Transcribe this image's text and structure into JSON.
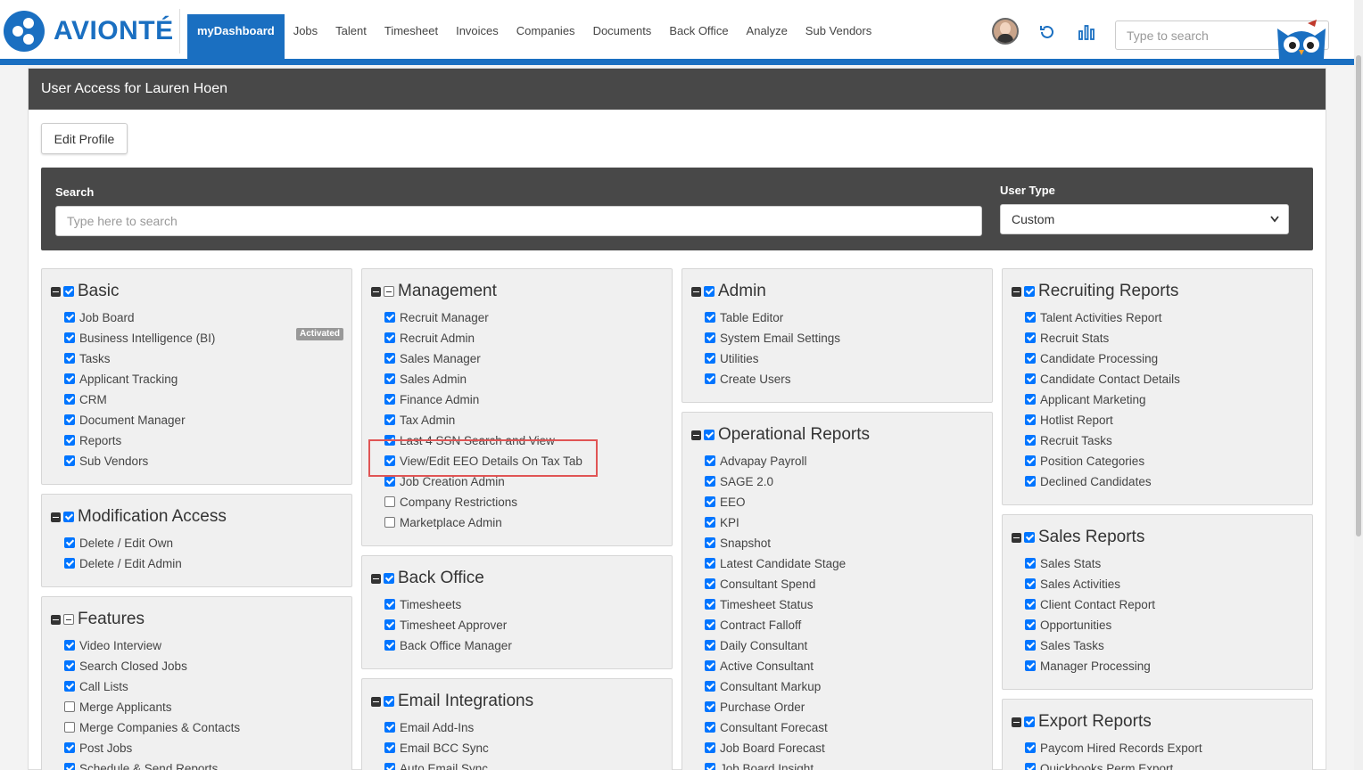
{
  "brand": {
    "name": "AVIONTÉ",
    "color": "#1a6fc1"
  },
  "nav": {
    "items": [
      "myDashboard",
      "Jobs",
      "Talent",
      "Timesheet",
      "Invoices",
      "Companies",
      "Documents",
      "Back Office",
      "Analyze",
      "Sub Vendors"
    ],
    "active_index": 0,
    "search_placeholder": "Type to search",
    "icons": [
      "user-avatar",
      "refresh-icon",
      "bar-chart-icon",
      "owl-mascot"
    ]
  },
  "panel": {
    "title": "User Access for Lauren Hoen",
    "edit_profile_label": "Edit Profile",
    "search_label": "Search",
    "search_placeholder": "Type here to search",
    "user_type_label": "User Type",
    "user_type_value": "Custom"
  },
  "groups": [
    {
      "title": "Basic",
      "state": "checked",
      "items": [
        {
          "label": "Job Board",
          "state": "checked"
        },
        {
          "label": "Business Intelligence (BI)",
          "state": "checked",
          "badge": "Activated"
        },
        {
          "label": "Tasks",
          "state": "checked"
        },
        {
          "label": "Applicant Tracking",
          "state": "checked"
        },
        {
          "label": "CRM",
          "state": "checked"
        },
        {
          "label": "Document Manager",
          "state": "checked"
        },
        {
          "label": "Reports",
          "state": "checked"
        },
        {
          "label": "Sub Vendors",
          "state": "checked"
        }
      ]
    },
    {
      "title": "Modification Access",
      "state": "checked",
      "items": [
        {
          "label": "Delete / Edit Own",
          "state": "checked"
        },
        {
          "label": "Delete / Edit Admin",
          "state": "checked"
        }
      ]
    },
    {
      "title": "Features",
      "state": "partial",
      "items": [
        {
          "label": "Video Interview",
          "state": "checked"
        },
        {
          "label": "Search Closed Jobs",
          "state": "checked"
        },
        {
          "label": "Call Lists",
          "state": "checked"
        },
        {
          "label": "Merge Applicants",
          "state": "unchecked"
        },
        {
          "label": "Merge Companies & Contacts",
          "state": "unchecked"
        },
        {
          "label": "Post Jobs",
          "state": "checked"
        },
        {
          "label": "Schedule & Send Reports",
          "state": "checked"
        }
      ]
    },
    {
      "title": "Management",
      "state": "partial",
      "items": [
        {
          "label": "Recruit Manager",
          "state": "checked"
        },
        {
          "label": "Recruit Admin",
          "state": "checked"
        },
        {
          "label": "Sales Manager",
          "state": "checked"
        },
        {
          "label": "Sales Admin",
          "state": "checked"
        },
        {
          "label": "Finance Admin",
          "state": "checked"
        },
        {
          "label": "Tax Admin",
          "state": "checked"
        },
        {
          "label": "Last 4 SSN Search and View",
          "state": "checked"
        },
        {
          "label": "View/Edit EEO Details On Tax Tab",
          "state": "checked"
        },
        {
          "label": "Job Creation Admin",
          "state": "checked"
        },
        {
          "label": "Company Restrictions",
          "state": "unchecked"
        },
        {
          "label": "Marketplace Admin",
          "state": "unchecked"
        }
      ]
    },
    {
      "title": "Back Office",
      "state": "checked",
      "items": [
        {
          "label": "Timesheets",
          "state": "checked"
        },
        {
          "label": "Timesheet Approver",
          "state": "checked"
        },
        {
          "label": "Back Office Manager",
          "state": "checked"
        }
      ]
    },
    {
      "title": "Email Integrations",
      "state": "checked",
      "items": [
        {
          "label": "Email Add-Ins",
          "state": "checked"
        },
        {
          "label": "Email BCC Sync",
          "state": "checked"
        },
        {
          "label": "Auto Email Sync",
          "state": "checked"
        }
      ]
    },
    {
      "title": "Admin",
      "state": "checked",
      "items": [
        {
          "label": "Table Editor",
          "state": "checked"
        },
        {
          "label": "System Email Settings",
          "state": "checked"
        },
        {
          "label": "Utilities",
          "state": "checked"
        },
        {
          "label": "Create Users",
          "state": "checked"
        }
      ]
    },
    {
      "title": "Operational Reports",
      "state": "checked",
      "items": [
        {
          "label": "Advapay Payroll",
          "state": "checked"
        },
        {
          "label": "SAGE 2.0",
          "state": "checked"
        },
        {
          "label": "EEO",
          "state": "checked"
        },
        {
          "label": "KPI",
          "state": "checked"
        },
        {
          "label": "Snapshot",
          "state": "checked"
        },
        {
          "label": "Latest Candidate Stage",
          "state": "checked"
        },
        {
          "label": "Consultant Spend",
          "state": "checked"
        },
        {
          "label": "Timesheet Status",
          "state": "checked"
        },
        {
          "label": "Contract Falloff",
          "state": "checked"
        },
        {
          "label": "Daily Consultant",
          "state": "checked"
        },
        {
          "label": "Active Consultant",
          "state": "checked"
        },
        {
          "label": "Consultant Markup",
          "state": "checked"
        },
        {
          "label": "Purchase Order",
          "state": "checked"
        },
        {
          "label": "Consultant Forecast",
          "state": "checked"
        },
        {
          "label": "Job Board Forecast",
          "state": "checked"
        },
        {
          "label": "Job Board Insight",
          "state": "checked"
        }
      ]
    },
    {
      "title": "Recruiting Reports",
      "state": "checked",
      "items": [
        {
          "label": "Talent Activities Report",
          "state": "checked"
        },
        {
          "label": "Recruit Stats",
          "state": "checked"
        },
        {
          "label": "Candidate Processing",
          "state": "checked"
        },
        {
          "label": "Candidate Contact Details",
          "state": "checked"
        },
        {
          "label": "Applicant Marketing",
          "state": "checked"
        },
        {
          "label": "Hotlist Report",
          "state": "checked"
        },
        {
          "label": "Recruit Tasks",
          "state": "checked"
        },
        {
          "label": "Position Categories",
          "state": "checked"
        },
        {
          "label": "Declined Candidates",
          "state": "checked"
        }
      ]
    },
    {
      "title": "Sales Reports",
      "state": "checked",
      "items": [
        {
          "label": "Sales Stats",
          "state": "checked"
        },
        {
          "label": "Sales Activities",
          "state": "checked"
        },
        {
          "label": "Client Contact Report",
          "state": "checked"
        },
        {
          "label": "Opportunities",
          "state": "checked"
        },
        {
          "label": "Sales Tasks",
          "state": "checked"
        },
        {
          "label": "Manager Processing",
          "state": "checked"
        }
      ]
    },
    {
      "title": "Export Reports",
      "state": "checked",
      "items": [
        {
          "label": "Paycom Hired Records Export",
          "state": "checked"
        },
        {
          "label": "Quickbooks Perm Export",
          "state": "checked"
        }
      ]
    }
  ],
  "annotation": {
    "highlight_color": "#e05555"
  }
}
